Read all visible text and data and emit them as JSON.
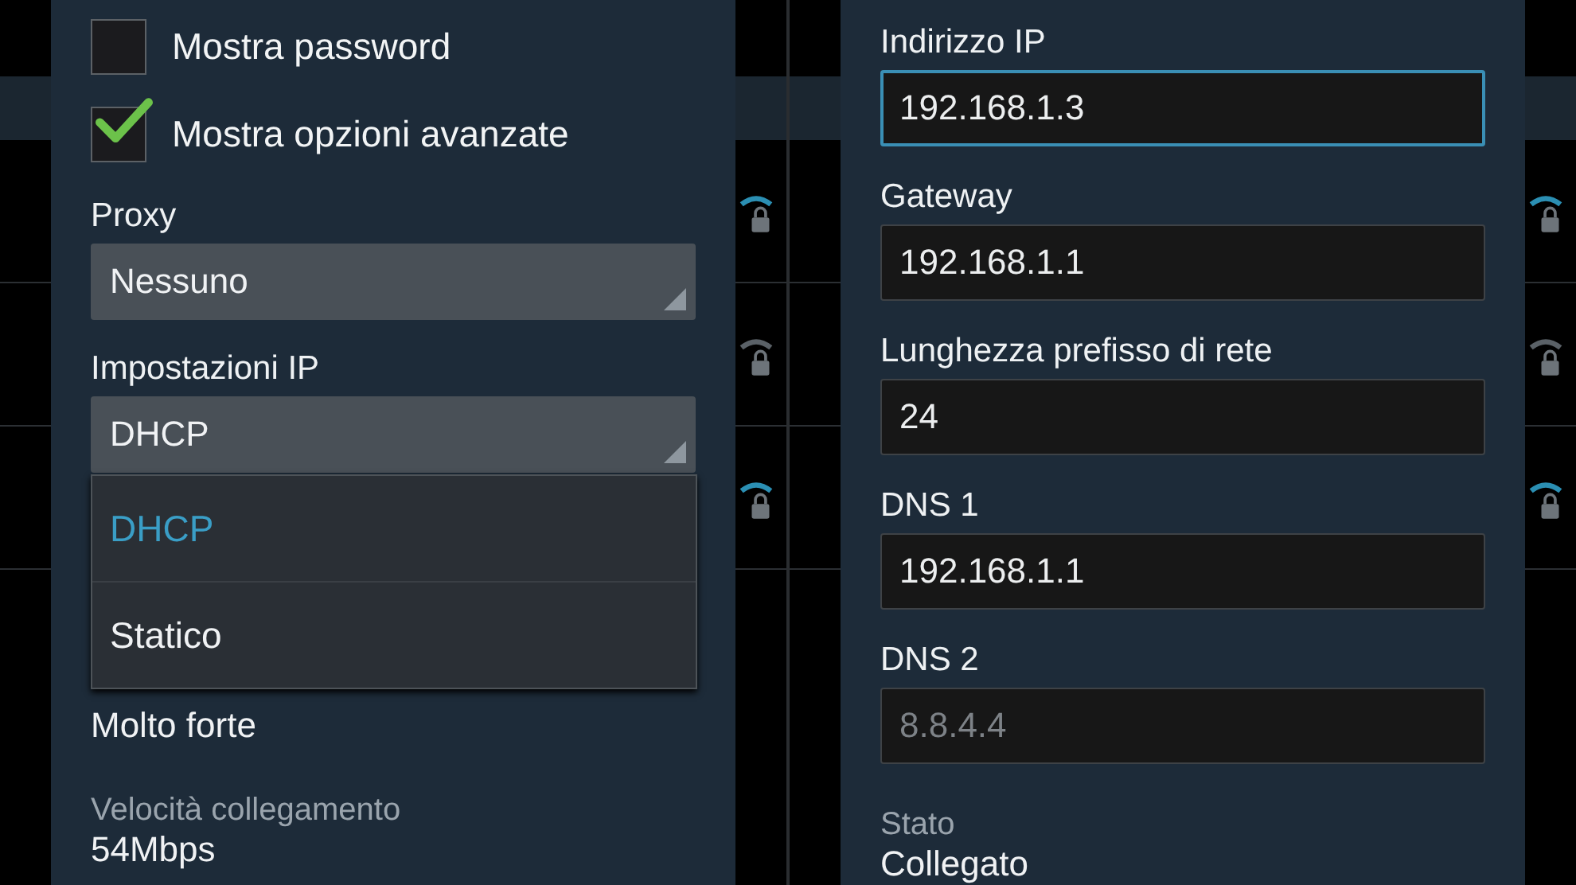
{
  "background_networks": [
    {
      "color": "#2b8fb3"
    },
    {
      "color": "#5a6167"
    },
    {
      "color": "#2b8fb3"
    }
  ],
  "left_screen": {
    "checkboxes": [
      {
        "label": "Mostra password",
        "checked": false
      },
      {
        "label": "Mostra opzioni avanzate",
        "checked": true
      }
    ],
    "spinners": [
      {
        "label": "Proxy",
        "value": "Nessuno"
      },
      {
        "label": "Impostazioni IP",
        "value": "DHCP"
      }
    ],
    "dropdown": {
      "options": [
        {
          "label": "DHCP",
          "selected": true
        },
        {
          "label": "Statico",
          "selected": false
        }
      ]
    },
    "info": [
      {
        "kind": "value",
        "text": "Molto forte"
      },
      {
        "kind": "label",
        "text": "Velocità collegamento"
      },
      {
        "kind": "value",
        "text": "54Mbps"
      }
    ]
  },
  "right_screen": {
    "fields": [
      {
        "label": "Indirizzo IP",
        "value": "192.168.1.3",
        "focused": true
      },
      {
        "label": "Gateway",
        "value": "192.168.1.1",
        "focused": false
      },
      {
        "label": "Lunghezza prefisso di rete",
        "value": "24",
        "focused": false
      },
      {
        "label": "DNS 1",
        "value": "192.168.1.1",
        "focused": false
      },
      {
        "label": "DNS 2",
        "placeholder": "8.8.4.4",
        "focused": false
      }
    ],
    "info": [
      {
        "kind": "label",
        "text": "Stato"
      },
      {
        "kind": "value",
        "text": "Collegato"
      }
    ]
  }
}
